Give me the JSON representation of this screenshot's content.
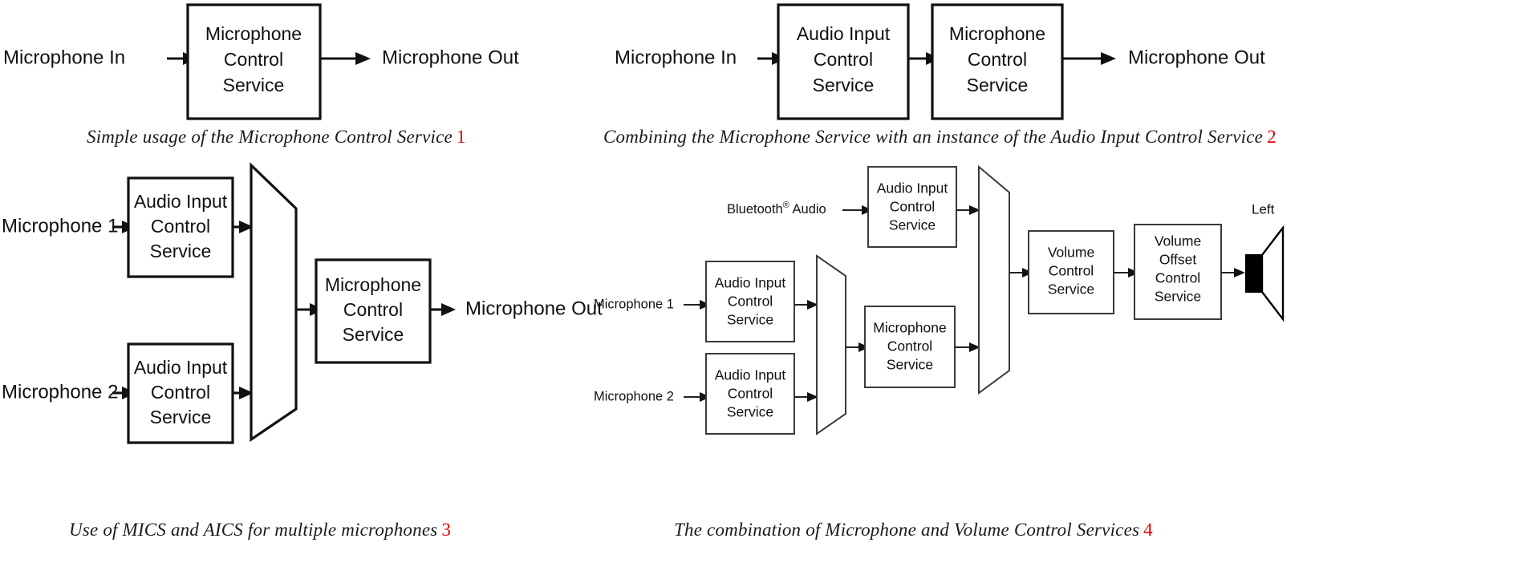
{
  "document": {
    "type": "block-diagram-sheet",
    "figure_number_color": "#e8000d"
  },
  "figures": [
    {
      "id": "fig1",
      "caption_text": "Simple usage of the Microphone Control Service",
      "caption_number": "1",
      "inputs": [
        "Microphone In"
      ],
      "outputs": [
        "Microphone Out"
      ],
      "blocks": [
        {
          "lines": [
            "Microphone",
            "Control",
            "Service"
          ]
        }
      ]
    },
    {
      "id": "fig2",
      "caption_text": "Combining the Microphone Service with an instance of the Audio Input Control Service",
      "caption_number": "2",
      "inputs": [
        "Microphone In"
      ],
      "outputs": [
        "Microphone Out"
      ],
      "blocks": [
        {
          "lines": [
            "Audio Input",
            "Control",
            "Service"
          ]
        },
        {
          "lines": [
            "Microphone",
            "Control",
            "Service"
          ]
        }
      ]
    },
    {
      "id": "fig3",
      "caption_text": "Use of MICS and AICS for multiple microphones",
      "caption_number": "3",
      "inputs": [
        "Microphone 1",
        "Microphone 2"
      ],
      "outputs": [
        "Microphone Out"
      ],
      "blocks": [
        {
          "lines": [
            "Audio Input",
            "Control",
            "Service"
          ]
        },
        {
          "lines": [
            "Audio Input",
            "Control",
            "Service"
          ]
        },
        {
          "lines": [
            "Microphone",
            "Control",
            "Service"
          ]
        }
      ],
      "mixers": [
        "mux"
      ]
    },
    {
      "id": "fig4",
      "caption_text": "The combination of Microphone and Volume Control Services",
      "caption_number": "4",
      "inputs": [
        "Bluetooth",
        "Microphone 1",
        "Microphone 2"
      ],
      "input_superscript": "®",
      "input_bluetooth_suffix": "Audio",
      "outputs": [
        "Left"
      ],
      "blocks": [
        {
          "lines": [
            "Audio Input",
            "Control",
            "Service"
          ]
        },
        {
          "lines": [
            "Audio Input",
            "Control",
            "Service"
          ]
        },
        {
          "lines": [
            "Audio Input",
            "Control",
            "Service"
          ]
        },
        {
          "lines": [
            "Microphone",
            "Control",
            "Service"
          ]
        },
        {
          "lines": [
            "Volume",
            "Control",
            "Service"
          ]
        },
        {
          "lines": [
            "Volume",
            "Offset",
            "Control",
            "Service"
          ]
        }
      ],
      "mixers": [
        "mux-lower",
        "mux-upper"
      ],
      "speaker_label": "Left"
    }
  ],
  "labels": {
    "microphone_in": "Microphone In",
    "microphone_out": "Microphone Out",
    "microphone_1": "Microphone 1",
    "microphone_2": "Microphone 2",
    "bluetooth_audio": "Bluetooth",
    "bluetooth_reg": "®",
    "audio_word": "Audio",
    "left": "Left",
    "audio_input": "Audio Input",
    "microphone": "Microphone",
    "volume": "Volume",
    "offset": "Offset",
    "control": "Control",
    "service": "Service"
  }
}
